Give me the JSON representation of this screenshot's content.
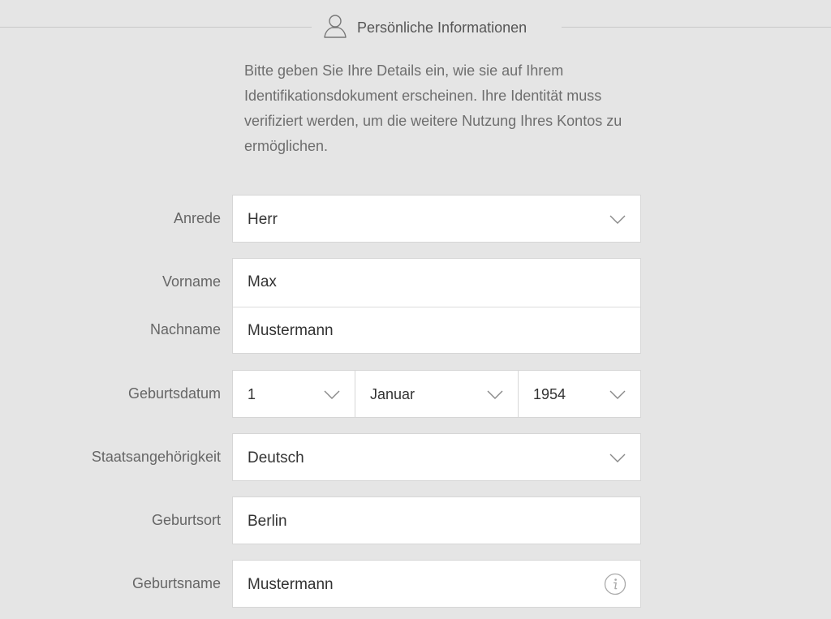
{
  "section": {
    "title": "Persönliche Informationen",
    "icon": "person-icon",
    "intro": "Bitte geben Sie Ihre Details ein, wie sie auf Ihrem Identifikationsdokument erscheinen. Ihre Identität muss verifiziert werden, um die weitere Nutzung Ihres Kontos zu ermöglichen."
  },
  "form": {
    "salutation": {
      "label": "Anrede",
      "value": "Herr"
    },
    "first_name": {
      "label": "Vorname",
      "value": "Max"
    },
    "last_name": {
      "label": "Nachname",
      "value": "Mustermann"
    },
    "birth_date": {
      "label": "Geburtsdatum",
      "day": "1",
      "month": "Januar",
      "year": "1954"
    },
    "nationality": {
      "label": "Staatsangehörigkeit",
      "value": "Deutsch"
    },
    "birth_place": {
      "label": "Geburtsort",
      "value": "Berlin"
    },
    "birth_name": {
      "label": "Geburtsname",
      "value": "Mustermann",
      "icon": "info-icon"
    }
  },
  "colors": {
    "background": "#e5e5e5",
    "field_background": "#ffffff",
    "border": "#d6d6d6",
    "label_text": "#666666"
  }
}
